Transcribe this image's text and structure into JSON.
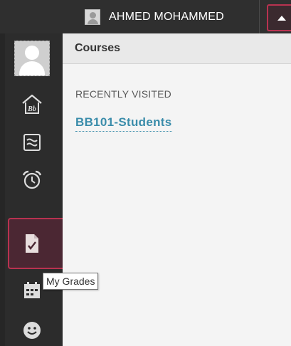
{
  "header": {
    "user_name": "AHMED MOHAMMED",
    "menu_toggle_icon": "caret-up-icon"
  },
  "rail": {
    "items": [
      {
        "name": "profile",
        "icon": "avatar-icon"
      },
      {
        "name": "institution",
        "icon": "blackboard-home-icon"
      },
      {
        "name": "activity-stream",
        "icon": "activity-stream-icon"
      },
      {
        "name": "calendar-due",
        "icon": "alarm-clock-icon"
      },
      {
        "name": "grades",
        "icon": "grades-icon",
        "active": true
      },
      {
        "name": "calendar",
        "icon": "calendar-icon"
      },
      {
        "name": "messages",
        "icon": "smiley-icon"
      }
    ]
  },
  "panel": {
    "title": "Courses",
    "section_label": "RECENTLY VISITED",
    "course_link": "BB101-Students"
  },
  "tooltip": {
    "text": "My Grades"
  },
  "colors": {
    "accent_border": "#b83250",
    "rail_bg": "#2c2c2c",
    "link": "#3a8caa"
  }
}
